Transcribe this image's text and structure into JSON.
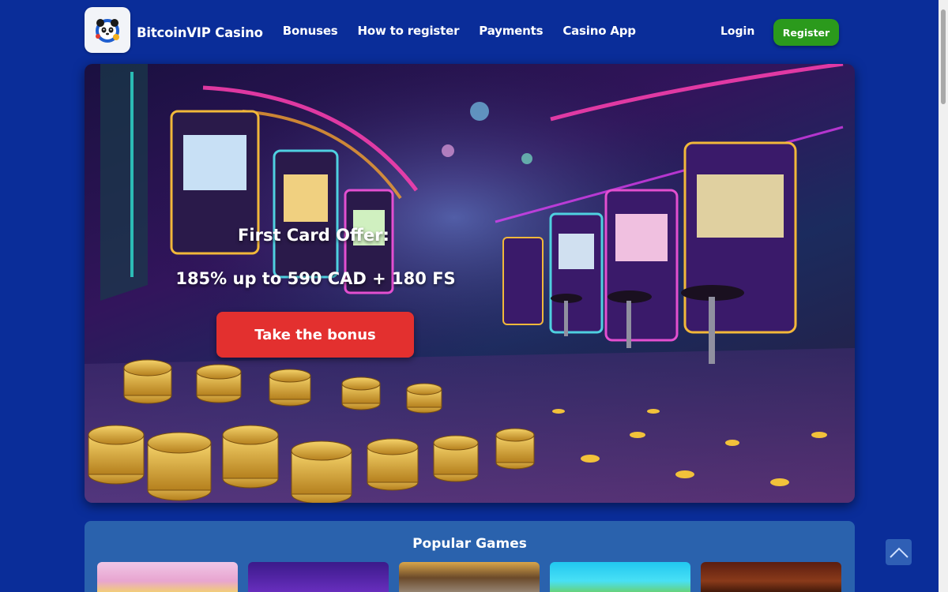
{
  "header": {
    "brand": "BitcoinVIP Casino",
    "nav": [
      "Bonuses",
      "How to register",
      "Payments",
      "Casino App"
    ],
    "login_label": "Login",
    "register_label": "Register"
  },
  "hero": {
    "title": "First Card Offer:",
    "offer": "185% up to 590 CAD + 180 FS",
    "button_label": "Take the bonus",
    "background_image": "casino-slots-coins-illustration"
  },
  "popular_games": {
    "title": "Popular Games",
    "tiles": [
      "game-thumbnail-1",
      "game-thumbnail-2",
      "game-thumbnail-3",
      "game-thumbnail-4",
      "game-thumbnail-5"
    ]
  },
  "colors": {
    "page_bg": "#0a2d99",
    "register_green": "#2b9a1c",
    "bonus_red": "#e3302f",
    "games_panel": "#2a62ad"
  },
  "icons": {
    "scroll_top": "chevron-up-icon",
    "logo": "panda-logo-icon"
  }
}
